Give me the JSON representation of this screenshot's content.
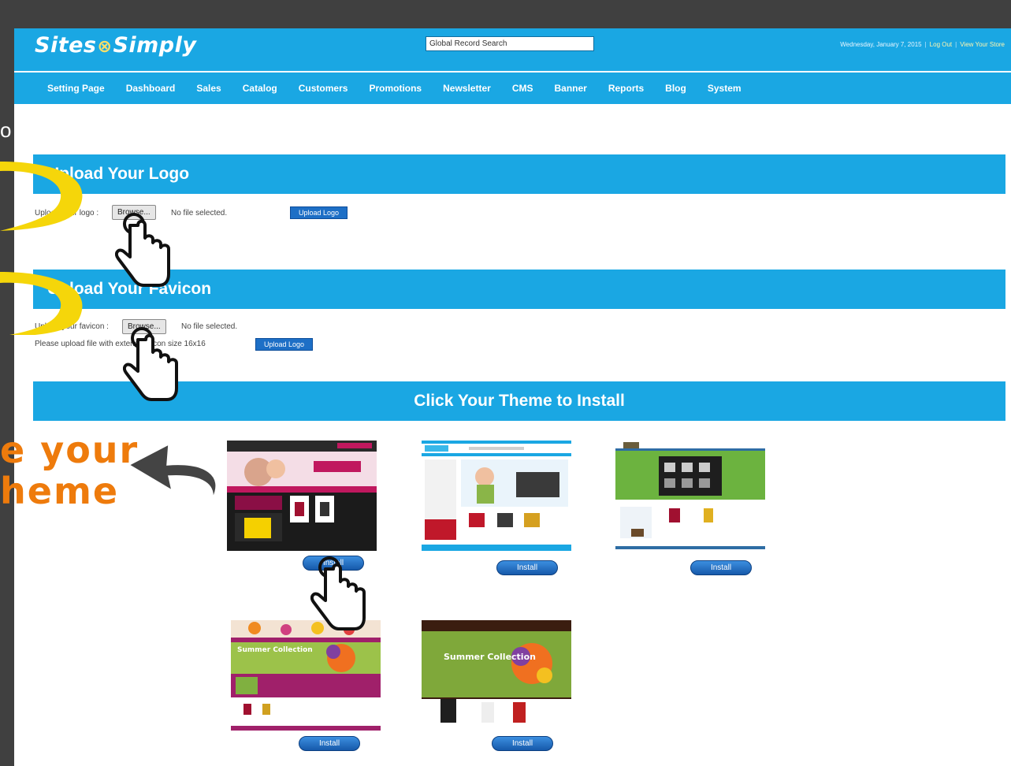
{
  "app": {
    "logo_left": "Sites",
    "logo_right": "Simply",
    "search_value": "Global Record Search",
    "date": "Wednesday, January 7, 2015",
    "logout": "Log Out",
    "view_store": "View Your Store"
  },
  "nav": [
    "Setting Page",
    "Dashboard",
    "Sales",
    "Catalog",
    "Customers",
    "Promotions",
    "Newsletter",
    "CMS",
    "Banner",
    "Reports",
    "Blog",
    "System"
  ],
  "logo_section": {
    "title": "Upload Your Logo",
    "label": "Upload your logo :",
    "browse": "Browse...",
    "file_status": "No file selected.",
    "button": "Upload Logo"
  },
  "favicon_section": {
    "title": "Upload Your Favicon",
    "label": "Upload your favicon :",
    "browse": "Browse...",
    "file_status": "No file selected.",
    "hint": "Please upload file with extension icon size 16x16",
    "button": "Upload Logo"
  },
  "theme_section": {
    "title": "Click Your Theme to Install",
    "install_label": "Install",
    "theme_mini_text": [
      "Summer Collection",
      "Summer Collection"
    ]
  },
  "overlay": {
    "left_fragment": "o",
    "callout_line1": "e your",
    "callout_line2": "heme"
  },
  "colors": {
    "brand_blue": "#1aa7e3",
    "button_blue": "#1d6fc6",
    "callout_orange": "#ee7b0c",
    "highlight_yellow": "#f5d60a",
    "frame_gray": "#404040"
  }
}
